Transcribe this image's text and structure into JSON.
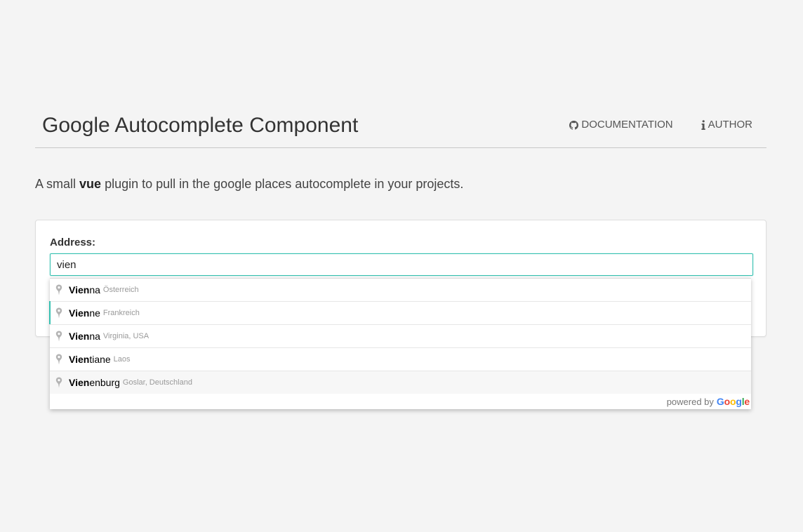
{
  "header": {
    "title": "Google Autocomplete Component",
    "nav": [
      {
        "label": "DOCUMENTATION",
        "icon": "github-icon"
      },
      {
        "label": "AUTHOR",
        "icon": "info-icon"
      }
    ]
  },
  "lead": {
    "before": "A small ",
    "bold": "vue",
    "after": " plugin to pull in the google places autocomplete in your projects."
  },
  "form": {
    "label": "Address:",
    "value": "vien"
  },
  "suggestions": [
    {
      "match": "Vien",
      "rest": "na",
      "secondary": "Österreich"
    },
    {
      "match": "Vien",
      "rest": "ne",
      "secondary": "Frankreich"
    },
    {
      "match": "Vien",
      "rest": "na",
      "secondary": "Virginia, USA"
    },
    {
      "match": "Vien",
      "rest": "tiane",
      "secondary": "Laos"
    },
    {
      "match": "Vien",
      "rest": "enburg",
      "secondary": "Goslar, Deutschland"
    }
  ],
  "footer": {
    "powered_by": "powered by",
    "logo_letters": [
      "G",
      "o",
      "o",
      "g",
      "l",
      "e"
    ],
    "logo_colors": [
      "#4285F4",
      "#EA4335",
      "#FBBC05",
      "#4285F4",
      "#34A853",
      "#EA4335"
    ]
  },
  "colors": {
    "accent": "#36c1b1",
    "background": "#f4f4f4"
  }
}
